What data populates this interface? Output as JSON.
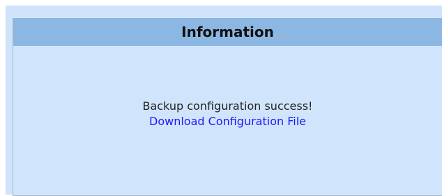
{
  "panel": {
    "title": "Information",
    "message": "Backup configuration success!",
    "link_label": "Download Configuration File"
  },
  "colors": {
    "background": "#cfe4fb",
    "header": "#8db7e3",
    "link": "#1a1aff"
  }
}
